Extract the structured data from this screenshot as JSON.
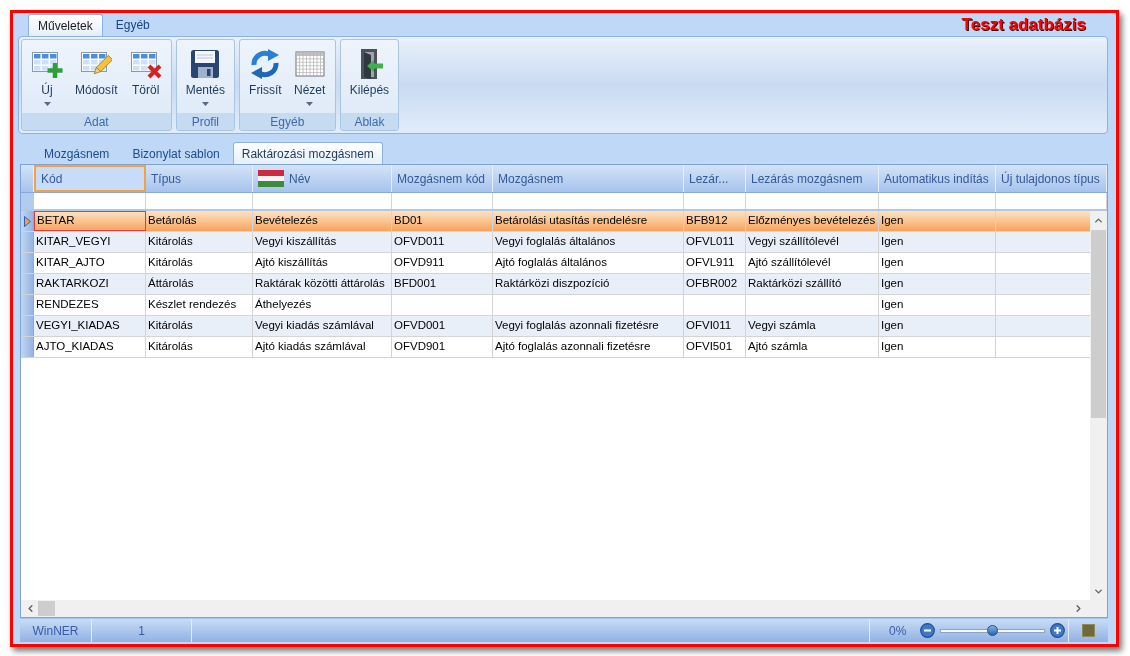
{
  "window": {
    "database_label": "Teszt adatbázis"
  },
  "ribbon": {
    "tabs": [
      {
        "label": "Műveletek",
        "selected": true
      },
      {
        "label": "Egyéb",
        "selected": false
      }
    ],
    "groups": [
      {
        "label": "Adat",
        "buttons": [
          {
            "label": "Új",
            "kind": "new",
            "dropdown": true
          },
          {
            "label": "Módosít",
            "kind": "edit",
            "dropdown": false
          },
          {
            "label": "Töröl",
            "kind": "delete",
            "dropdown": false
          }
        ]
      },
      {
        "label": "Profil",
        "buttons": [
          {
            "label": "Mentés",
            "kind": "save",
            "dropdown": true
          }
        ]
      },
      {
        "label": "Egyéb",
        "buttons": [
          {
            "label": "Frissít",
            "kind": "refresh",
            "dropdown": false
          },
          {
            "label": "Nézet",
            "kind": "view",
            "dropdown": true
          }
        ]
      },
      {
        "label": "Ablak",
        "buttons": [
          {
            "label": "Kilépés",
            "kind": "exit",
            "dropdown": false
          }
        ]
      }
    ]
  },
  "document_tabs": [
    {
      "label": "Mozgásnem",
      "selected": false
    },
    {
      "label": "Bizonylat sablon",
      "selected": false
    },
    {
      "label": "Raktározási mozgásnem",
      "selected": true
    }
  ],
  "grid": {
    "columns": [
      {
        "label": "Kód",
        "kind": "plain",
        "focused": true
      },
      {
        "label": "Típus",
        "kind": "plain",
        "focused": false
      },
      {
        "label": "Név",
        "kind": "flag",
        "focused": false
      },
      {
        "label": "Mozgásnem kód",
        "kind": "plain",
        "focused": false
      },
      {
        "label": "Mozgásnem",
        "kind": "plain",
        "focused": false
      },
      {
        "label": "Lezár...",
        "kind": "plain",
        "focused": false
      },
      {
        "label": "Lezárás mozgásnem",
        "kind": "plain",
        "focused": false
      },
      {
        "label": "Automatikus indítás",
        "kind": "plain",
        "focused": false
      },
      {
        "label": "Új tulajdonos típus",
        "kind": "plain",
        "focused": false
      }
    ],
    "rows": [
      {
        "selected": true,
        "cells": [
          "BETAR",
          "Betárolás",
          "Bevételezés",
          "BD01",
          "Betárolási utasítás rendelésre",
          "BFB912",
          "Előzményes bevételezés",
          "Igen"
        ]
      },
      {
        "selected": false,
        "cells": [
          "KITAR_VEGYI",
          "Kitárolás",
          "Vegyi kiszállítás",
          "OFVD011",
          "Vegyi foglalás általános",
          "OFVL011",
          "Vegyi szállítólevél",
          "Igen"
        ]
      },
      {
        "selected": false,
        "cells": [
          "KITAR_AJTO",
          "Kitárolás",
          "Ajtó kiszállítás",
          "OFVD911",
          "Ajtó foglalás általános",
          "OFVL911",
          "Ajtó szállítólevél",
          "Igen"
        ]
      },
      {
        "selected": false,
        "cells": [
          "RAKTARKOZI",
          "Áttárolás",
          "Raktárak közötti áttárolás",
          "BFD001",
          "Raktárközi diszpozíció",
          "OFBR002",
          "Raktárközi szállító",
          "Igen"
        ]
      },
      {
        "selected": false,
        "cells": [
          "RENDEZES",
          "Készlet rendezés",
          "Áthelyezés",
          null,
          null,
          null,
          null,
          "Igen"
        ]
      },
      {
        "selected": false,
        "cells": [
          "VEGYI_KIADAS",
          "Kitárolás",
          "Vegyi kiadás számlával",
          "OFVD001",
          "Vegyi foglalás azonnali fizetésre",
          "OFVI011",
          "Vegyi számla",
          "Igen"
        ]
      },
      {
        "selected": false,
        "cells": [
          "AJTO_KIADAS",
          "Kitárolás",
          "Ajtó kiadás számlával",
          "OFVD901",
          "Ajtó foglalás azonnali fizetésre",
          "OFVI501",
          "Ajtó számla",
          "Igen"
        ]
      }
    ]
  },
  "status_bar": {
    "panels": [
      "WinNER",
      "1"
    ],
    "zoom": {
      "reading": "0%",
      "level": 0.5
    }
  }
}
